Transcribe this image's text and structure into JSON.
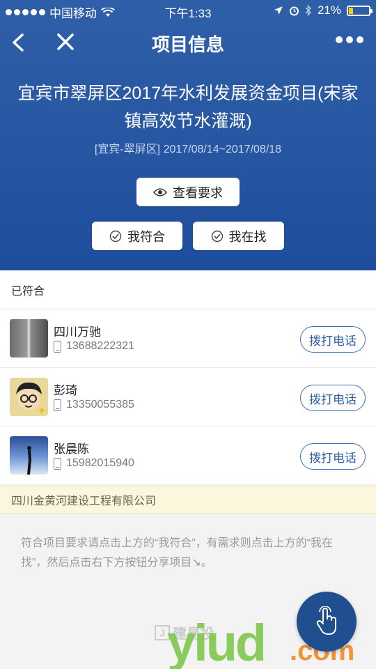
{
  "status_bar": {
    "carrier": "中国移动",
    "time": "下午1:33",
    "battery_percent": "21%",
    "battery_level": 0.21
  },
  "nav": {
    "title": "项目信息"
  },
  "project": {
    "title": "宜宾市翠屏区2017年水利发展资金项目(宋家镇高效节水灌溉)",
    "meta": "[宜宾-翠屏区] 2017/08/14~2017/08/18"
  },
  "actions": {
    "view_requirements": "查看要求",
    "i_match": "我符合",
    "i_seek": "我在找"
  },
  "list": {
    "section_title": "已符合",
    "call_label": "拨打电话",
    "items": [
      {
        "name": "四川万驰",
        "phone": "13688222321"
      },
      {
        "name": "彭琦",
        "phone": "13350055385"
      },
      {
        "name": "张晨陈",
        "phone": "15982015940"
      }
    ]
  },
  "company": "四川金黄河建设工程有限公司",
  "tip": "符合项目要求请点击上方的“我符合”，有需求则点击上方的“我在找”，然后点击右下方按钮分享项目↘。",
  "watermark": {
    "brand_cn": "建易投",
    "brand_logo": "yiud",
    "brand_suffix": ".com"
  },
  "colors": {
    "header_blue": "#2a59a4",
    "call_border": "#3a6fb0",
    "fab": "#1f4f8f"
  }
}
